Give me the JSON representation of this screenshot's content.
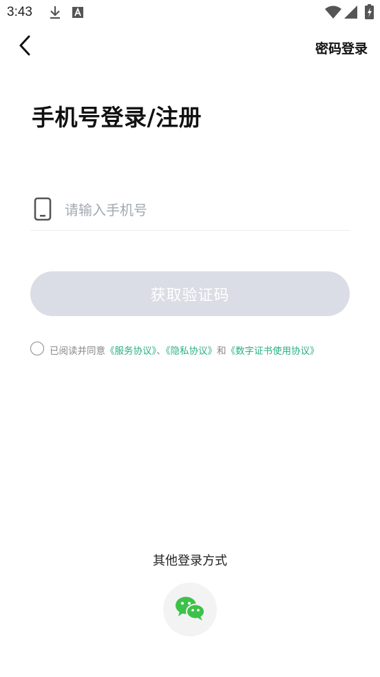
{
  "status_bar": {
    "time": "3:43",
    "icons": [
      "download-icon",
      "font-icon",
      "wifi-icon",
      "signal-icon",
      "battery-icon"
    ]
  },
  "header": {
    "back_icon": "chevron-left-icon",
    "password_login_label": "密码登录"
  },
  "title": "手机号登录/注册",
  "phone_field": {
    "icon": "phone-icon",
    "placeholder": "请输入手机号",
    "value": ""
  },
  "get_code_button": {
    "label": "获取验证码",
    "enabled": false
  },
  "agreement": {
    "checked": false,
    "prefix": "已阅读并同意",
    "service_link": "《服务协议》",
    "sep1": "、",
    "privacy_link": "《隐私协议》",
    "and": "和",
    "cert_link": "《数字证书使用协议》"
  },
  "other_login": {
    "label": "其他登录方式",
    "wechat_icon": "wechat-icon"
  },
  "colors": {
    "accent_link": "#2bb07f",
    "button_disabled": "#dadde5",
    "wechat_green": "#3ec14a"
  }
}
